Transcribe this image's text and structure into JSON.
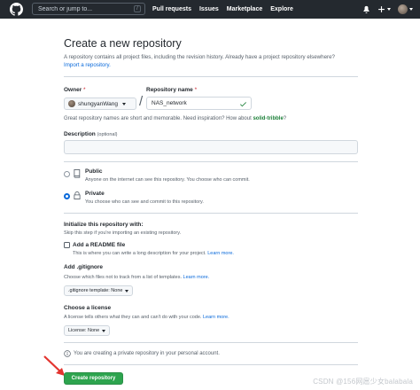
{
  "topbar": {
    "search_placeholder": "Search or jump to...",
    "search_key": "/",
    "nav": [
      "Pull requests",
      "Issues",
      "Marketplace",
      "Explore"
    ],
    "icons": [
      "github-logo-icon",
      "bell-icon",
      "plus-icon",
      "avatar"
    ]
  },
  "page": {
    "title": "Create a new repository",
    "subtitle": "A repository contains all project files, including the revision history. Already have a project repository elsewhere?",
    "import_link": "Import a repository."
  },
  "owner": {
    "label": "Owner",
    "required_mark": "*",
    "value": "shungyanWang"
  },
  "repo_name": {
    "label": "Repository name",
    "required_mark": "*",
    "value": "NAS_network",
    "separator": "/"
  },
  "name_hint": {
    "text": "Great repository names are short and memorable. Need inspiration? How about",
    "suggestion": "solid-tribble",
    "end": "?"
  },
  "description": {
    "label": "Description",
    "optional": "(optional)",
    "value": ""
  },
  "visibility": {
    "selected": "private",
    "public_title": "Public",
    "public_desc": "Anyone on the internet can see this repository. You choose who can commit.",
    "private_title": "Private",
    "private_desc": "You choose who can see and commit to this repository."
  },
  "initialize": {
    "title": "Initialize this repository with:",
    "desc": "Skip this step if you're importing an existing repository.",
    "readme_label": "Add a README file",
    "readme_checked": false,
    "readme_desc": "This is where you can write a long description for your project.",
    "readme_link": "Learn more."
  },
  "gitignore": {
    "title": "Add .gitignore",
    "desc": "Choose which files not to track from a list of templates.",
    "link": "Learn more.",
    "select_label": ".gitignore template: None"
  },
  "license": {
    "title": "Choose a license",
    "desc": "A license tells others what they can and can't do with your code.",
    "link": "Learn more.",
    "select_label": "License: None"
  },
  "footer": {
    "info": "You are creating a private repository in your personal account.",
    "create_button": "Create repository",
    "watermark": "CSDN @156网扈少女balabala"
  },
  "colors": {
    "header_bg": "#24292f",
    "primary_button": "#2da44e",
    "link": "#0969da",
    "arrow": "#e3342f"
  }
}
